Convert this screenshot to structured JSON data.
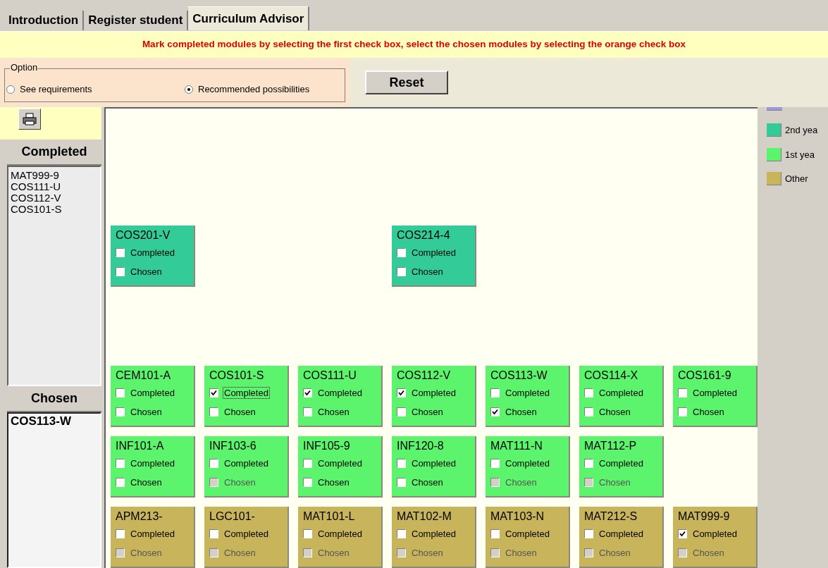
{
  "tabs": [
    {
      "label": "Introduction",
      "selected": false
    },
    {
      "label": "Register student",
      "selected": false
    },
    {
      "label": "Curriculum  Advisor",
      "selected": true
    }
  ],
  "instruction": "Mark completed modules by selecting the first check box, select the chosen modules by selecting the orange check box",
  "option_group": {
    "legend": "Option",
    "options": [
      {
        "label": "See requirements",
        "selected": false
      },
      {
        "label": "Recommended possibilities",
        "selected": true
      }
    ]
  },
  "reset_button": "Reset",
  "completed_panel": {
    "heading": "Completed",
    "items": [
      "MAT999-9",
      "COS111-U",
      "COS112-V",
      "COS101-S"
    ]
  },
  "chosen_panel": {
    "heading": "Chosen",
    "items": [
      "COS113-W"
    ]
  },
  "module_rows": [
    [
      {
        "code": "COS201-V",
        "color": "#33cc99",
        "completed": {
          "label": "Completed",
          "checked": false,
          "focused": false
        },
        "chosen": {
          "label": "Chosen",
          "checked": false,
          "disabled": false
        }
      },
      {
        "code": "COS214-4",
        "color": "#33cc99",
        "completed": {
          "label": "Completed",
          "checked": false,
          "focused": false
        },
        "chosen": {
          "label": "Chosen",
          "checked": false,
          "disabled": false
        }
      }
    ],
    [
      {
        "code": "CEM101-A",
        "color": "#5cf46c",
        "completed": {
          "label": "Completed",
          "checked": false,
          "focused": false
        },
        "chosen": {
          "label": "Chosen",
          "checked": false,
          "disabled": false
        }
      },
      {
        "code": "COS101-S",
        "color": "#5cf46c",
        "completed": {
          "label": "Completed",
          "checked": true,
          "focused": true
        },
        "chosen": {
          "label": "Chosen",
          "checked": false,
          "disabled": false
        }
      },
      {
        "code": "COS111-U",
        "color": "#5cf46c",
        "completed": {
          "label": "Completed",
          "checked": true,
          "focused": false
        },
        "chosen": {
          "label": "Chosen",
          "checked": false,
          "disabled": false
        }
      },
      {
        "code": "COS112-V",
        "color": "#5cf46c",
        "completed": {
          "label": "Completed",
          "checked": true,
          "focused": false
        },
        "chosen": {
          "label": "Chosen",
          "checked": false,
          "disabled": false
        }
      },
      {
        "code": "COS113-W",
        "color": "#5cf46c",
        "completed": {
          "label": "Completed",
          "checked": false,
          "focused": false
        },
        "chosen": {
          "label": "Chosen",
          "checked": true,
          "disabled": false
        }
      },
      {
        "code": "COS114-X",
        "color": "#5cf46c",
        "completed": {
          "label": "Completed",
          "checked": false,
          "focused": false
        },
        "chosen": {
          "label": "Chosen",
          "checked": false,
          "disabled": false
        }
      },
      {
        "code": "COS161-9",
        "color": "#5cf46c",
        "completed": {
          "label": "Completed",
          "checked": false,
          "focused": false
        },
        "chosen": {
          "label": "Chosen",
          "checked": false,
          "disabled": false
        }
      }
    ],
    [
      {
        "code": "INF101-A",
        "color": "#5cf46c",
        "completed": {
          "label": "Completed",
          "checked": false,
          "focused": false
        },
        "chosen": {
          "label": "Chosen",
          "checked": false,
          "disabled": false
        }
      },
      {
        "code": "INF103-6",
        "color": "#5cf46c",
        "completed": {
          "label": "Completed",
          "checked": false,
          "focused": false
        },
        "chosen": {
          "label": "Chosen",
          "checked": false,
          "disabled": true
        }
      },
      {
        "code": "INF105-9",
        "color": "#5cf46c",
        "completed": {
          "label": "Completed",
          "checked": false,
          "focused": false
        },
        "chosen": {
          "label": "Chosen",
          "checked": false,
          "disabled": false
        }
      },
      {
        "code": "INF120-8",
        "color": "#5cf46c",
        "completed": {
          "label": "Completed",
          "checked": false,
          "focused": false
        },
        "chosen": {
          "label": "Chosen",
          "checked": false,
          "disabled": false
        }
      },
      {
        "code": "MAT111-N",
        "color": "#5cf46c",
        "completed": {
          "label": "Completed",
          "checked": false,
          "focused": false
        },
        "chosen": {
          "label": "Chosen",
          "checked": false,
          "disabled": true
        }
      },
      {
        "code": "MAT112-P",
        "color": "#5cf46c",
        "completed": {
          "label": "Completed",
          "checked": false,
          "focused": false
        },
        "chosen": {
          "label": "Chosen",
          "checked": false,
          "disabled": true
        }
      }
    ],
    [
      {
        "code": "APM213-",
        "color": "#c8b45a",
        "completed": {
          "label": "Completed",
          "checked": false,
          "focused": false
        },
        "chosen": {
          "label": "Chosen",
          "checked": false,
          "disabled": true
        }
      },
      {
        "code": "LGC101-",
        "color": "#c8b45a",
        "completed": {
          "label": "Completed",
          "checked": false,
          "focused": false
        },
        "chosen": {
          "label": "Chosen",
          "checked": false,
          "disabled": true
        }
      },
      {
        "code": "MAT101-L",
        "color": "#c8b45a",
        "completed": {
          "label": "Completed",
          "checked": false,
          "focused": false
        },
        "chosen": {
          "label": "Chosen",
          "checked": false,
          "disabled": true
        }
      },
      {
        "code": "MAT102-M",
        "color": "#c8b45a",
        "completed": {
          "label": "Completed",
          "checked": false,
          "focused": false
        },
        "chosen": {
          "label": "Chosen",
          "checked": false,
          "disabled": true
        }
      },
      {
        "code": "MAT103-N",
        "color": "#c8b45a",
        "completed": {
          "label": "Completed",
          "checked": false,
          "focused": false
        },
        "chosen": {
          "label": "Chosen",
          "checked": false,
          "disabled": true
        }
      },
      {
        "code": "MAT212-S",
        "color": "#c8b45a",
        "completed": {
          "label": "Completed",
          "checked": false,
          "focused": false
        },
        "chosen": {
          "label": "Chosen",
          "checked": false,
          "disabled": true
        }
      },
      {
        "code": "MAT999-9",
        "color": "#c8b45a",
        "completed": {
          "label": "Completed",
          "checked": true,
          "focused": false
        },
        "chosen": {
          "label": "Chosen",
          "checked": false,
          "disabled": true
        }
      }
    ]
  ],
  "legend": [
    {
      "color": "#9a9ae0"
    },
    {
      "label": "2nd yea",
      "color": "#33cc99"
    },
    {
      "label": "1st yea",
      "color": "#5cf46c"
    },
    {
      "label": "Other",
      "color": "#c8b45a"
    }
  ]
}
